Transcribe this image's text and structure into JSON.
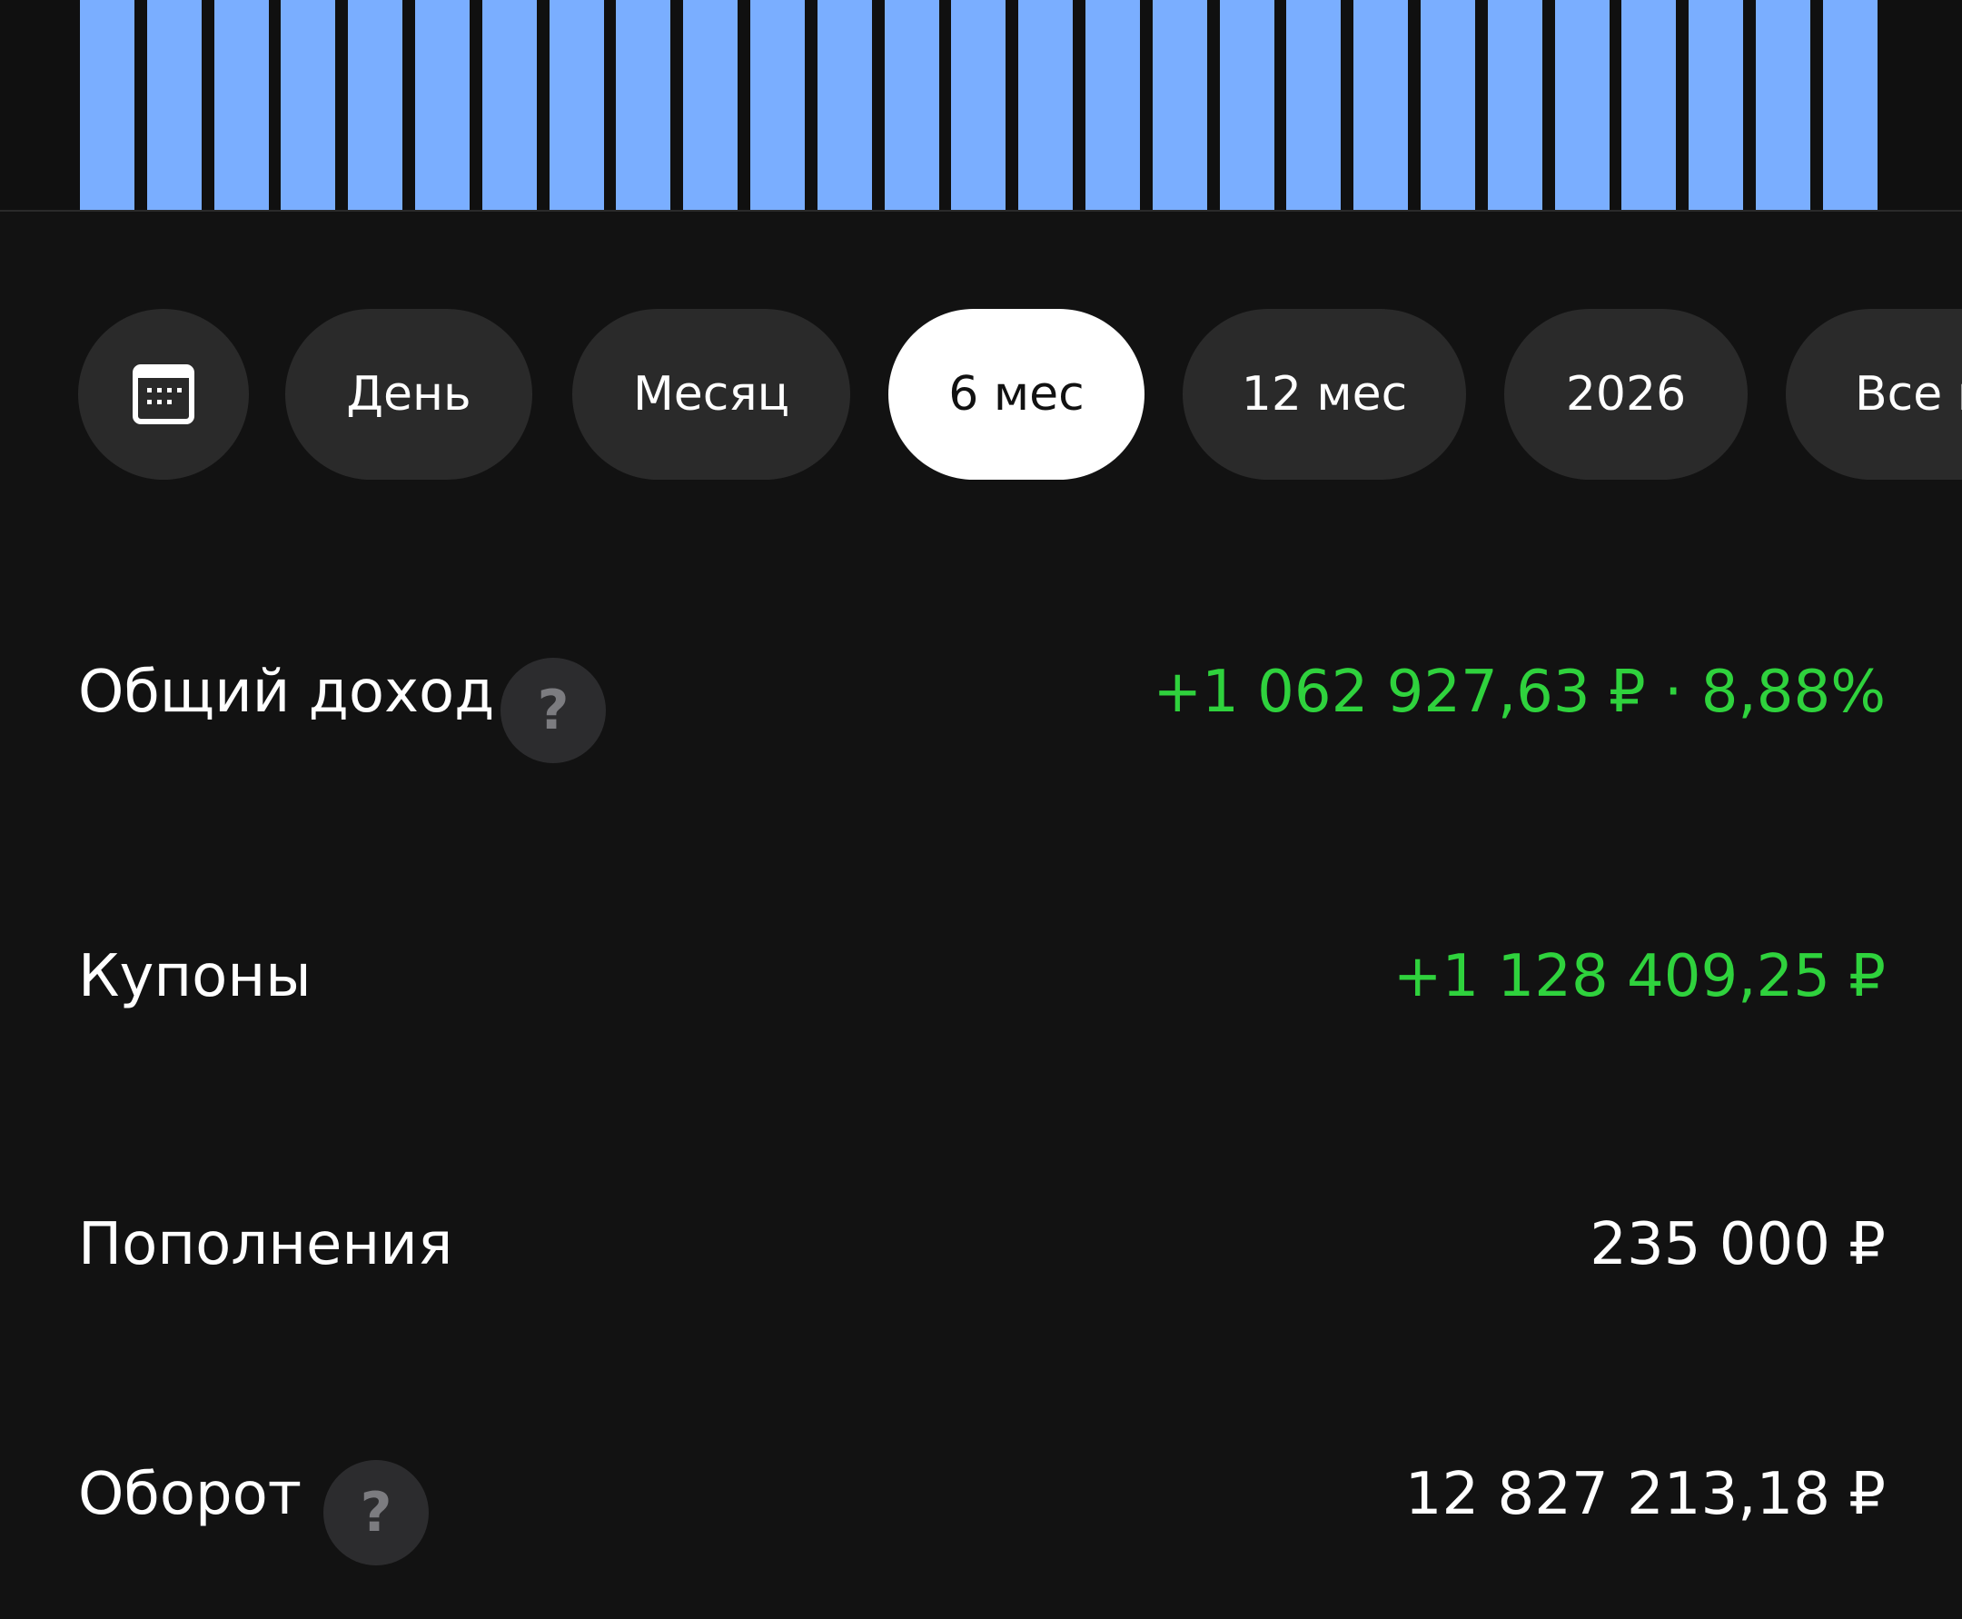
{
  "chart": {
    "bar_count": 27,
    "bar_color": "#7aaeff"
  },
  "period_selector": {
    "calendar_icon": "calendar-icon",
    "options": [
      "День",
      "Месяц",
      "6 мес",
      "12 мес",
      "2026",
      "Все в"
    ],
    "selected": "6 мес"
  },
  "summary": {
    "total_income": {
      "label": "Общий доход",
      "value": "+1 062 927,63 ₽ · 8,88%",
      "help_icon": "?"
    },
    "coupons": {
      "label": "Купоны",
      "value": "+1 128 409,25 ₽"
    },
    "deposits": {
      "label": "Пополнения",
      "value": "235 000 ₽"
    },
    "turnover": {
      "label": "Оборот",
      "value": "12 827 213,18 ₽",
      "help_icon": "?"
    }
  },
  "colors": {
    "background": "#121212",
    "chip_background": "#2a2a2a",
    "chip_active_background": "#ffffff",
    "positive": "#2fd23d"
  }
}
